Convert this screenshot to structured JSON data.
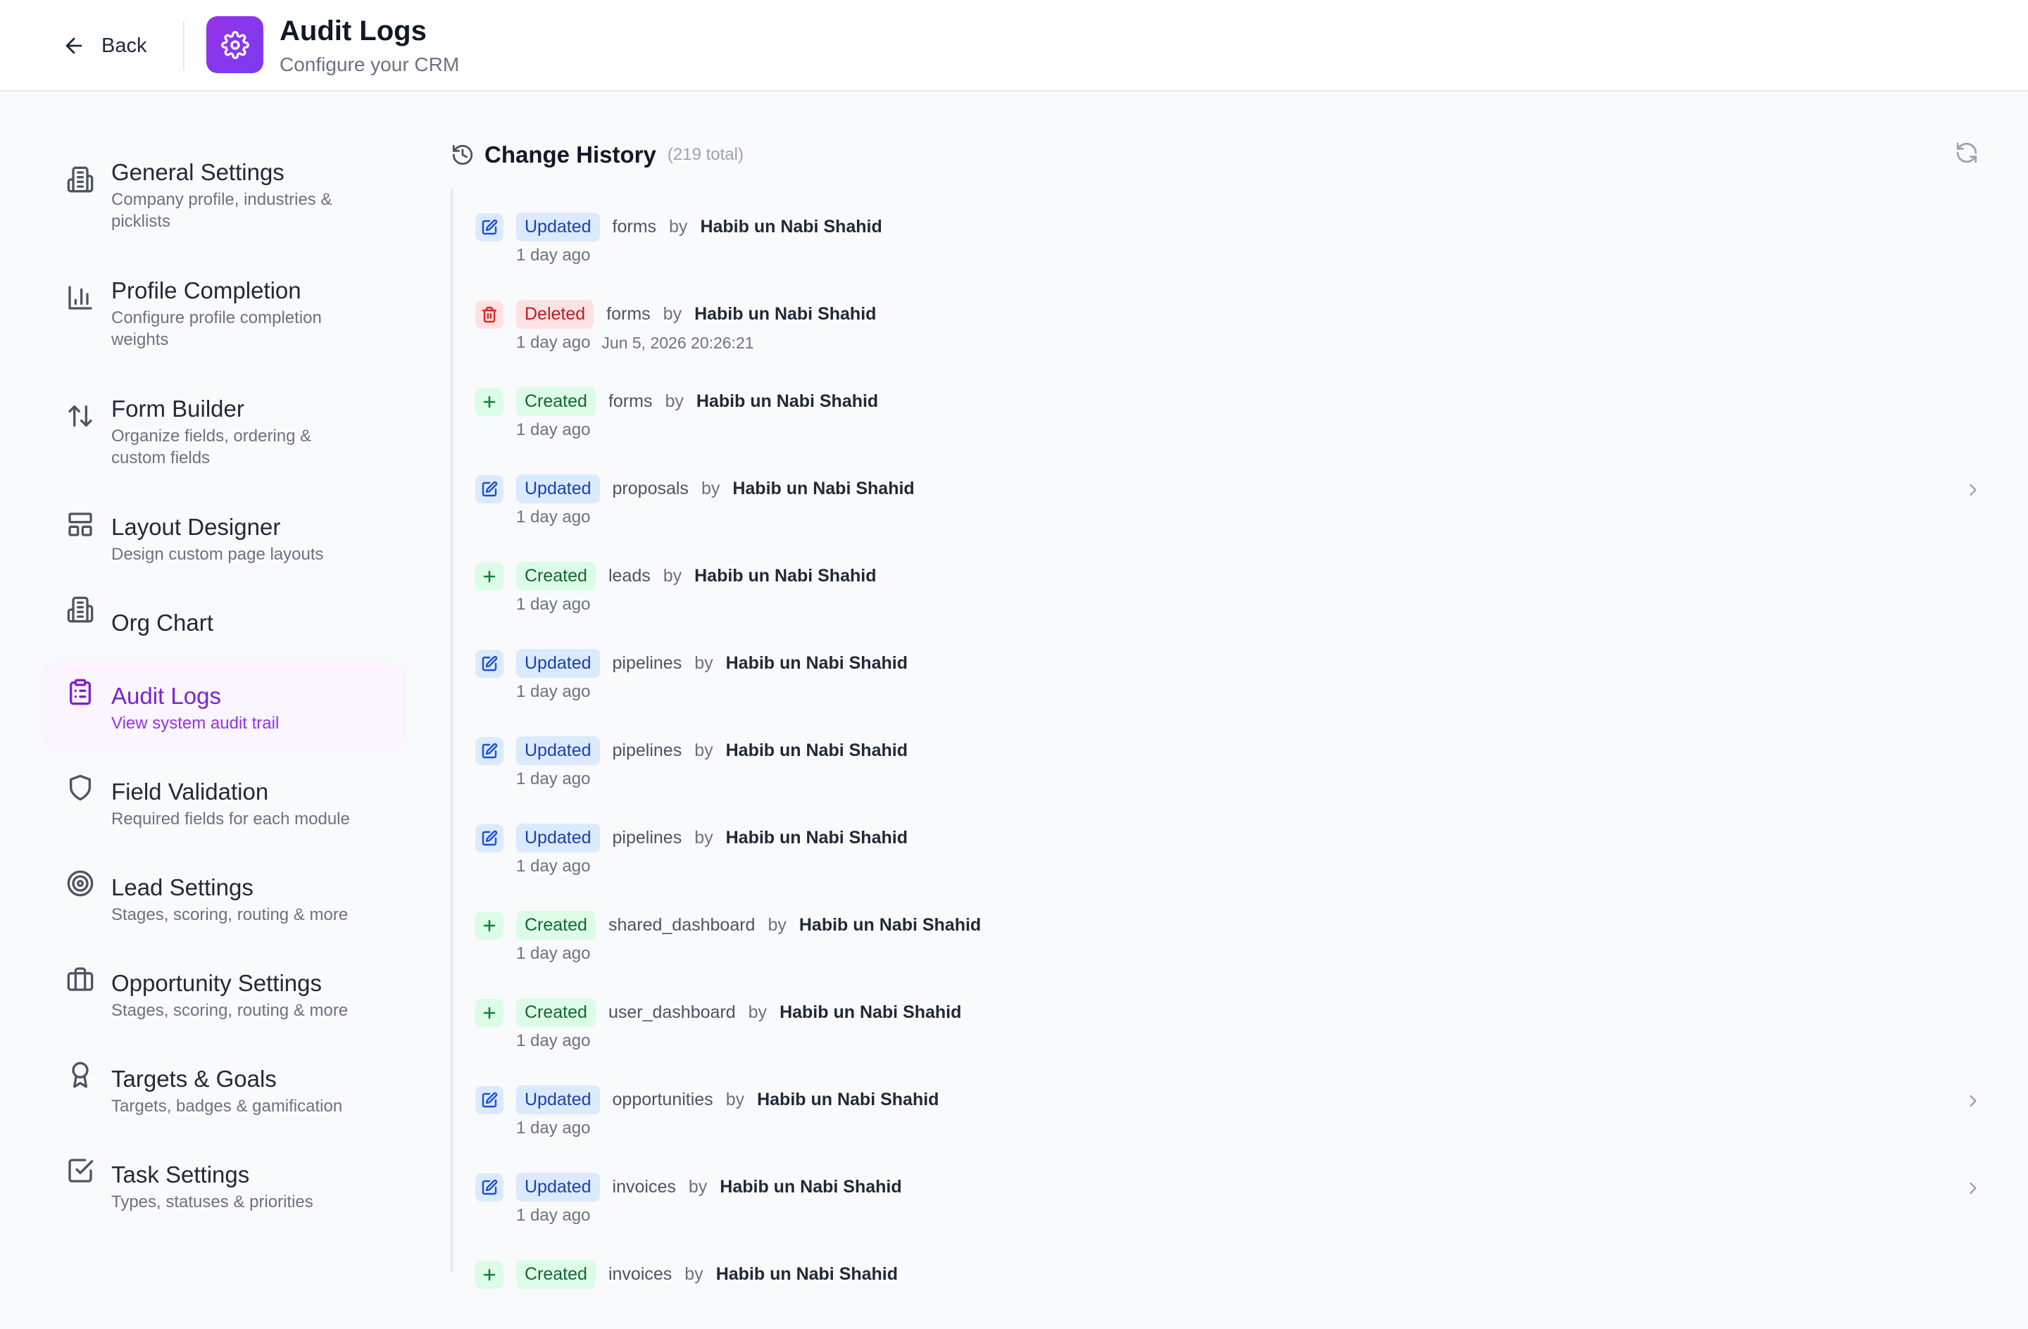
{
  "header": {
    "back_label": "Back",
    "title": "Audit Logs",
    "subtitle": "Configure your CRM",
    "icon": "gear-icon"
  },
  "sidebar": {
    "items": [
      {
        "title": "General Settings",
        "desc": "Company profile, industries & picklists",
        "icon": "building-icon"
      },
      {
        "title": "Profile Completion",
        "desc": "Configure profile completion weights",
        "icon": "bar-chart-icon"
      },
      {
        "title": "Form Builder",
        "desc": "Organize fields, ordering & custom fields",
        "icon": "sort-arrows-icon"
      },
      {
        "title": "Layout Designer",
        "desc": "Design custom page layouts",
        "icon": "layout-icon"
      },
      {
        "title": "Org Chart",
        "desc": "",
        "icon": "building-icon"
      },
      {
        "title": "Audit Logs",
        "desc": "View system audit trail",
        "icon": "clipboard-list-icon",
        "active": true
      },
      {
        "title": "Field Validation",
        "desc": "Required fields for each module",
        "icon": "shield-icon"
      },
      {
        "title": "Lead Settings",
        "desc": "Stages, scoring, routing & more",
        "icon": "target-icon"
      },
      {
        "title": "Opportunity Settings",
        "desc": "Stages, scoring, routing & more",
        "icon": "briefcase-icon"
      },
      {
        "title": "Targets & Goals",
        "desc": "Targets, badges & gamification",
        "icon": "award-icon"
      },
      {
        "title": "Task Settings",
        "desc": "Types, statuses & priorities",
        "icon": "check-square-icon"
      }
    ]
  },
  "main": {
    "title": "Change History",
    "count": "(219 total)",
    "by_label": "by",
    "entries": [
      {
        "action": "Updated",
        "type": "updated",
        "entity": "forms",
        "user": "Habib un Nabi Shahid",
        "time": "1 day ago",
        "timestamp": "",
        "chevron": false
      },
      {
        "action": "Deleted",
        "type": "deleted",
        "entity": "forms",
        "user": "Habib un Nabi Shahid",
        "time": "1 day ago",
        "timestamp": "Jun 5, 2026 20:26:21",
        "chevron": false
      },
      {
        "action": "Created",
        "type": "created",
        "entity": "forms",
        "user": "Habib un Nabi Shahid",
        "time": "1 day ago",
        "timestamp": "",
        "chevron": false
      },
      {
        "action": "Updated",
        "type": "updated",
        "entity": "proposals",
        "user": "Habib un Nabi Shahid",
        "time": "1 day ago",
        "timestamp": "",
        "chevron": true
      },
      {
        "action": "Created",
        "type": "created",
        "entity": "leads",
        "user": "Habib un Nabi Shahid",
        "time": "1 day ago",
        "timestamp": "",
        "chevron": false
      },
      {
        "action": "Updated",
        "type": "updated",
        "entity": "pipelines",
        "user": "Habib un Nabi Shahid",
        "time": "1 day ago",
        "timestamp": "",
        "chevron": false
      },
      {
        "action": "Updated",
        "type": "updated",
        "entity": "pipelines",
        "user": "Habib un Nabi Shahid",
        "time": "1 day ago",
        "timestamp": "",
        "chevron": false
      },
      {
        "action": "Updated",
        "type": "updated",
        "entity": "pipelines",
        "user": "Habib un Nabi Shahid",
        "time": "1 day ago",
        "timestamp": "",
        "chevron": false
      },
      {
        "action": "Created",
        "type": "created",
        "entity": "shared_dashboard",
        "user": "Habib un Nabi Shahid",
        "time": "1 day ago",
        "timestamp": "",
        "chevron": false
      },
      {
        "action": "Created",
        "type": "created",
        "entity": "user_dashboard",
        "user": "Habib un Nabi Shahid",
        "time": "1 day ago",
        "timestamp": "",
        "chevron": false
      },
      {
        "action": "Updated",
        "type": "updated",
        "entity": "opportunities",
        "user": "Habib un Nabi Shahid",
        "time": "1 day ago",
        "timestamp": "",
        "chevron": true
      },
      {
        "action": "Updated",
        "type": "updated",
        "entity": "invoices",
        "user": "Habib un Nabi Shahid",
        "time": "1 day ago",
        "timestamp": "",
        "chevron": true
      },
      {
        "action": "Created",
        "type": "created",
        "entity": "invoices",
        "user": "Habib un Nabi Shahid",
        "time": "",
        "timestamp": "",
        "chevron": false
      }
    ]
  },
  "colors": {
    "accent": "#7e22ce",
    "updated": "#1e40af",
    "deleted": "#b91c1c",
    "created": "#166534"
  }
}
